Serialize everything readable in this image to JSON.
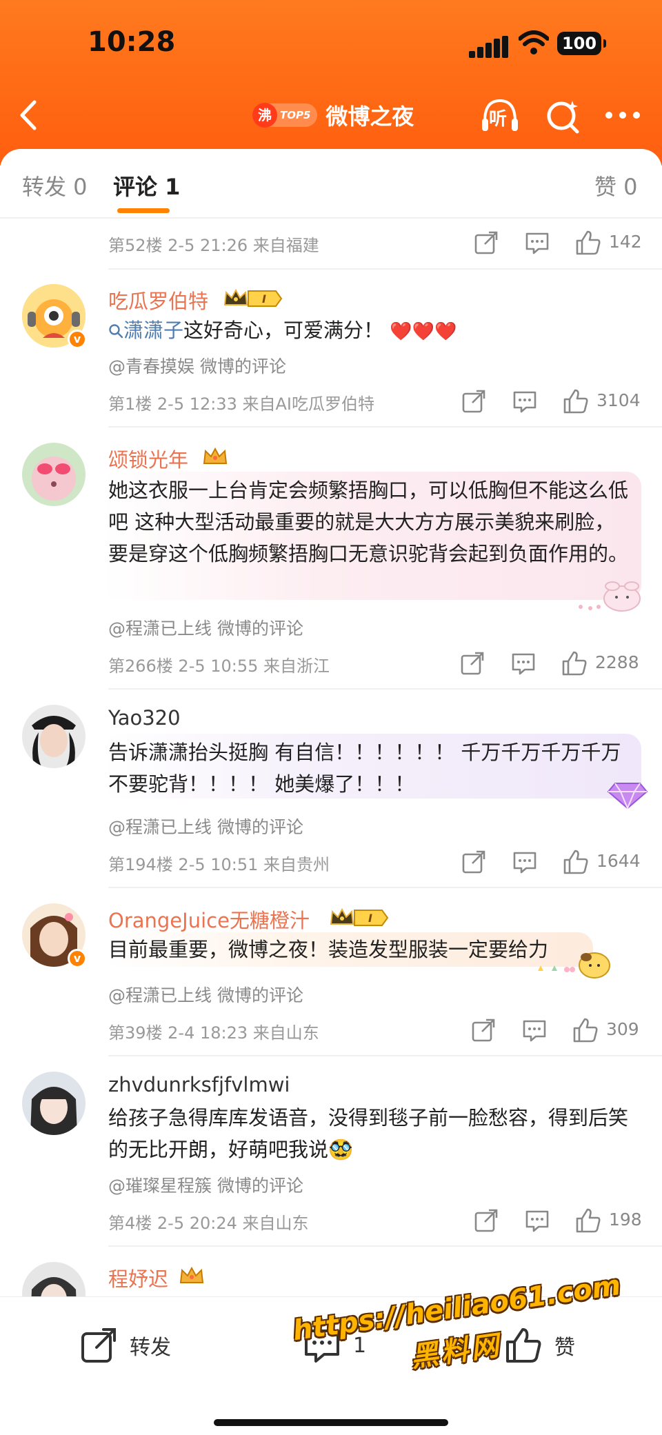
{
  "status_bar": {
    "time": "10:28",
    "battery": "100"
  },
  "nav": {
    "hot_rank_icon": "沸",
    "hot_rank_badge": "TOP5",
    "title": "微博之夜",
    "listen_label": "听",
    "icons": [
      "back-arrow-icon",
      "headphone-icon",
      "search-ai-icon",
      "more-dots-icon"
    ]
  },
  "tabs": {
    "repost": "转发 0",
    "comment": "评论 1",
    "like": "赞 0",
    "accent_color": "#ff8200"
  },
  "comments": [
    {
      "meta": "第52楼 2-5 21:26 来自福建",
      "likes": "142"
    },
    {
      "username": "吃瓜罗伯特",
      "level": "I",
      "mention": "潇潇子",
      "text": "这好奇心，可爱满分！",
      "emoji": "❤️❤️❤️",
      "source": "@青春摸娱 微博的评论",
      "meta": "第1楼 2-5 12:33 来自AI吃瓜罗伯特",
      "likes": "3104"
    },
    {
      "username": "颂锁光年",
      "text": "她这衣服一上台肯定会频繁捂胸口，可以低胸但不能这么低吧 这种大型活动最重要的就是大大方方展示美貌来刷脸，要是穿这个低胸频繁捂胸口无意识驼背会起到负面作用的。",
      "source": "@程潇已上线 微博的评论",
      "meta": "第266楼 2-5 10:55 来自浙江",
      "likes": "2288"
    },
    {
      "username": "Yao320",
      "text": "告诉潇潇抬头挺胸 有自信！！！！！！ 千万千万千万千万不要驼背！！！！ 她美爆了！！！",
      "source": "@程潇已上线 微博的评论",
      "meta": "第194楼 2-5 10:51 来自贵州",
      "likes": "1644"
    },
    {
      "username": "OrangeJuice无糖橙汁",
      "level": "I",
      "text": "目前最重要，微博之夜！装造发型服装一定要给力",
      "source": "@程潇已上线 微博的评论",
      "meta": "第39楼 2-4 18:23 来自山东",
      "likes": "309"
    },
    {
      "username": "zhvdunrksfjfvlmwi",
      "text": "给孩子急得库库发语音，没得到毯子前一脸愁容，得到后笑的无比开朗，好萌吧我说🥸",
      "source": "@璀璨星程簇 微博的评论",
      "meta": "第4楼 2-5 20:24 来自山东",
      "likes": "198"
    },
    {
      "username": "程妤迟"
    }
  ],
  "bottom_bar": {
    "repost_label": "转发",
    "comment_count": "1",
    "like_label": "赞"
  },
  "watermark": {
    "line1": "https://heiliao61.com",
    "line2": "黑料网"
  }
}
